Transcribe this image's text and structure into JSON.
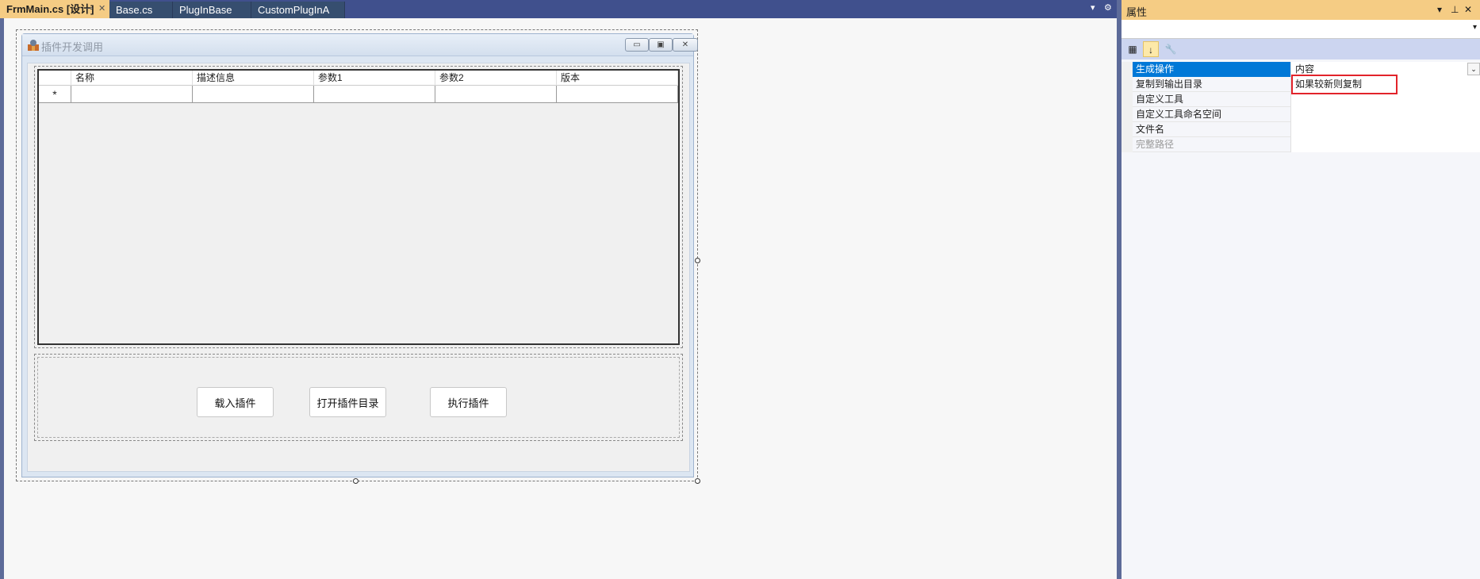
{
  "editor": {
    "tabs": [
      {
        "label": "FrmMain.cs [设计]",
        "active": true
      },
      {
        "label": "Base.cs",
        "active": false
      },
      {
        "label": "PlugInBase",
        "active": false
      },
      {
        "label": "CustomPlugInA",
        "active": false
      }
    ],
    "pin_glyph": "⊸",
    "close_glyph": "✕",
    "overflow_glyph": "▾",
    "settings_glyph": "⚙"
  },
  "form": {
    "title": "插件开发调用",
    "minimize_glyph": "▭",
    "restore_glyph": "▣",
    "close_glyph": "✕",
    "grid": {
      "columns": [
        "名称",
        "描述信息",
        "参数1",
        "参数2",
        "版本"
      ],
      "new_row_marker": "*"
    },
    "buttons": {
      "load": "载入插件",
      "open_dir": "打开插件目录",
      "execute": "执行插件"
    }
  },
  "properties": {
    "title": "属性",
    "title_controls": {
      "dropdown": "▾",
      "pin": "⊥",
      "close": "✕"
    },
    "selector_arrow": "▾",
    "toolbar": {
      "categorized": "▦",
      "alphabetical": "↓",
      "property_pages": "🔧"
    },
    "rows": [
      {
        "name": "生成操作",
        "value": "内容"
      },
      {
        "name": "复制到输出目录",
        "value": "如果较新则复制"
      },
      {
        "name": "自定义工具",
        "value": ""
      },
      {
        "name": "自定义工具命名空间",
        "value": ""
      },
      {
        "name": "文件名",
        "value": ""
      },
      {
        "name": "完整路径",
        "value": ""
      }
    ],
    "dropdown_glyph": "⌄"
  },
  "colors": {
    "tab_active": "#f5cc84",
    "tab_inactive": "#364e6f",
    "selection": "#0078d7",
    "highlight": "#e2232a"
  }
}
